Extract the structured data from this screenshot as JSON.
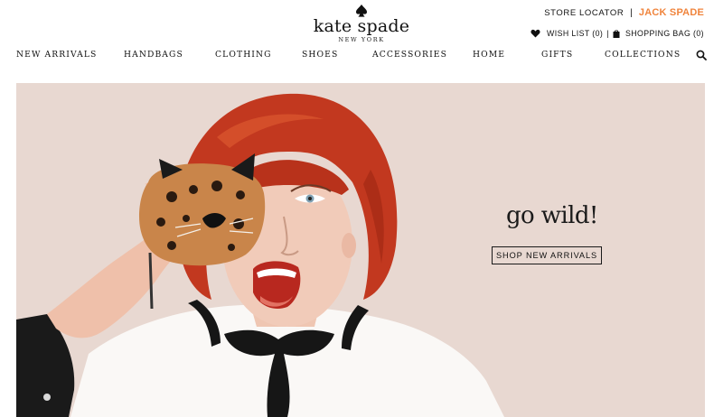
{
  "brand": {
    "name": "kate spade",
    "subtitle": "NEW YORK"
  },
  "utility": {
    "store_locator": "STORE LOCATOR",
    "separator": "|",
    "jack_spade": "JACK SPADE",
    "wish_list": "WISH LIST (0)",
    "divider": "|",
    "shopping_bag": "SHOPPING BAG (0)"
  },
  "nav": {
    "items": [
      "NEW ARRIVALS",
      "HANDBAGS",
      "CLOTHING",
      "SHOES",
      "ACCESSORIES",
      "HOME",
      "GIFTS",
      "COLLECTIONS"
    ],
    "search_icon": "search-icon"
  },
  "hero": {
    "headline": "go wild!",
    "cta": "SHOP NEW ARRIVALS"
  },
  "icons": {
    "spade": "spade-icon",
    "heart": "heart-icon",
    "bag": "shopping-bag-icon"
  },
  "colors": {
    "jack_spade": "#f0843c",
    "hero_background": "#e7d6cf",
    "hair": "#c2381f",
    "text": "#111111"
  }
}
